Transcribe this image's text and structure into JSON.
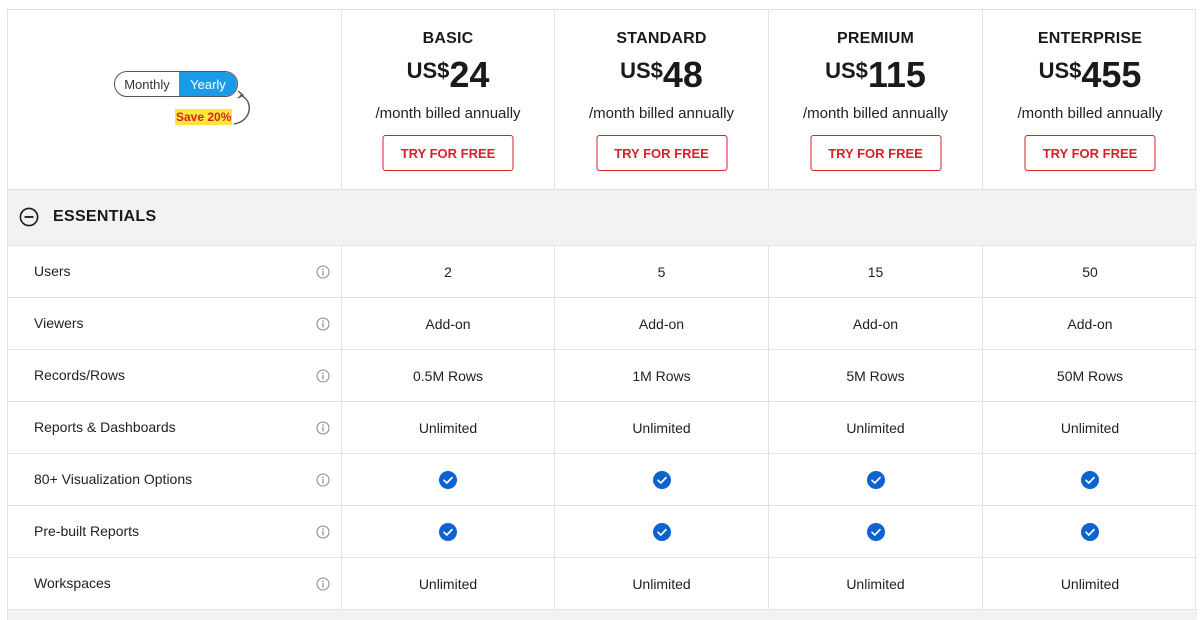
{
  "billing_toggle": {
    "monthly_label": "Monthly",
    "yearly_label": "Yearly",
    "selected": "Yearly",
    "save_badge": "Save 20%"
  },
  "plans": [
    {
      "name": "BASIC",
      "currency": "US$",
      "amount": "24",
      "billing": "/month billed annually",
      "cta": "TRY FOR FREE"
    },
    {
      "name": "STANDARD",
      "currency": "US$",
      "amount": "48",
      "billing": "/month billed annually",
      "cta": "TRY FOR FREE"
    },
    {
      "name": "PREMIUM",
      "currency": "US$",
      "amount": "115",
      "billing": "/month billed annually",
      "cta": "TRY FOR FREE"
    },
    {
      "name": "ENTERPRISE",
      "currency": "US$",
      "amount": "455",
      "billing": "/month billed annually",
      "cta": "TRY FOR FREE"
    }
  ],
  "section": {
    "title": "ESSENTIALS",
    "expanded": true
  },
  "features": [
    {
      "label": "Users",
      "values": [
        "2",
        "5",
        "15",
        "50"
      ]
    },
    {
      "label": "Viewers",
      "values": [
        "Add-on",
        "Add-on",
        "Add-on",
        "Add-on"
      ]
    },
    {
      "label": "Records/Rows",
      "values": [
        "0.5M Rows",
        "1M Rows",
        "5M Rows",
        "50M Rows"
      ]
    },
    {
      "label": "Reports & Dashboards",
      "values": [
        "Unlimited",
        "Unlimited",
        "Unlimited",
        "Unlimited"
      ]
    },
    {
      "label": "80+ Visualization Options",
      "values": [
        true,
        true,
        true,
        true
      ]
    },
    {
      "label": "Pre-built Reports",
      "values": [
        true,
        true,
        true,
        true
      ]
    },
    {
      "label": "Workspaces",
      "values": [
        "Unlimited",
        "Unlimited",
        "Unlimited",
        "Unlimited"
      ]
    }
  ],
  "icons": {
    "info": "info-icon",
    "check": "check-circle-icon",
    "collapse": "minus-circle-icon",
    "arrow": "curved-arrow-icon"
  },
  "colors": {
    "accent_blue": "#1a9be8",
    "check_blue": "#0b63d0",
    "cta_red": "#d8202b",
    "save_highlight": "#ffe63a",
    "section_bg": "#f2f2f3"
  }
}
